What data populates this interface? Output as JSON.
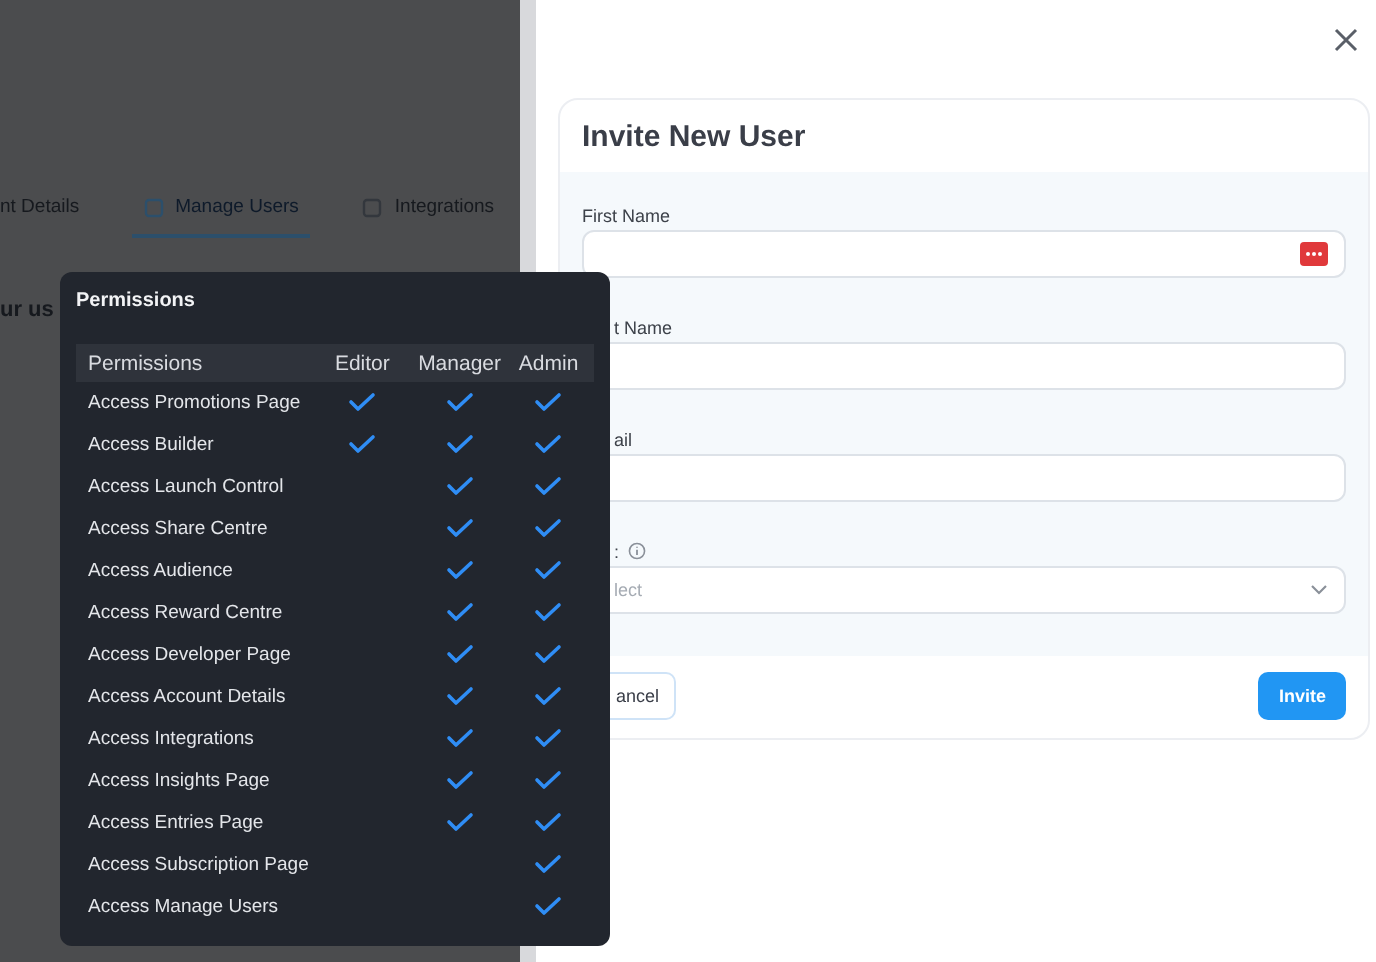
{
  "background": {
    "tabs": [
      {
        "label": "nt Details",
        "selected": false,
        "icon": false
      },
      {
        "label": "Manage Users",
        "selected": true,
        "icon": true
      },
      {
        "label": "Integrations",
        "selected": false,
        "icon": true
      }
    ],
    "text": "ur us"
  },
  "permissions": {
    "title": "Permissions",
    "columns": [
      "Permissions",
      "Editor",
      "Manager",
      "Admin"
    ],
    "rows": [
      {
        "name": "Access Promotions Page",
        "editor": true,
        "manager": true,
        "admin": true
      },
      {
        "name": "Access Builder",
        "editor": true,
        "manager": true,
        "admin": true
      },
      {
        "name": "Access Launch Control",
        "editor": false,
        "manager": true,
        "admin": true
      },
      {
        "name": "Access Share Centre",
        "editor": false,
        "manager": true,
        "admin": true
      },
      {
        "name": "Access Audience",
        "editor": false,
        "manager": true,
        "admin": true
      },
      {
        "name": "Access Reward Centre",
        "editor": false,
        "manager": true,
        "admin": true
      },
      {
        "name": "Access Developer Page",
        "editor": false,
        "manager": true,
        "admin": true
      },
      {
        "name": "Access Account Details",
        "editor": false,
        "manager": true,
        "admin": true
      },
      {
        "name": "Access Integrations",
        "editor": false,
        "manager": true,
        "admin": true
      },
      {
        "name": "Access Insights Page",
        "editor": false,
        "manager": true,
        "admin": true
      },
      {
        "name": "Access Entries Page",
        "editor": false,
        "manager": true,
        "admin": true
      },
      {
        "name": "Access Subscription Page",
        "editor": false,
        "manager": false,
        "admin": true
      },
      {
        "name": "Access Manage Users",
        "editor": false,
        "manager": false,
        "admin": true
      }
    ]
  },
  "drawer": {
    "title": "Invite New User",
    "fields": [
      {
        "label": "First Name",
        "kind": "text",
        "autofill_icon": true,
        "info": false
      },
      {
        "label": "t Name",
        "kind": "text",
        "autofill_icon": false,
        "info": false
      },
      {
        "label": "ail",
        "kind": "text",
        "autofill_icon": false,
        "info": false
      },
      {
        "label": ":",
        "kind": "select",
        "placeholder": "lect",
        "info": true
      }
    ],
    "buttons": [
      {
        "label": "ancel",
        "kind": "secondary"
      },
      {
        "label": "Invite",
        "kind": "primary"
      }
    ]
  }
}
